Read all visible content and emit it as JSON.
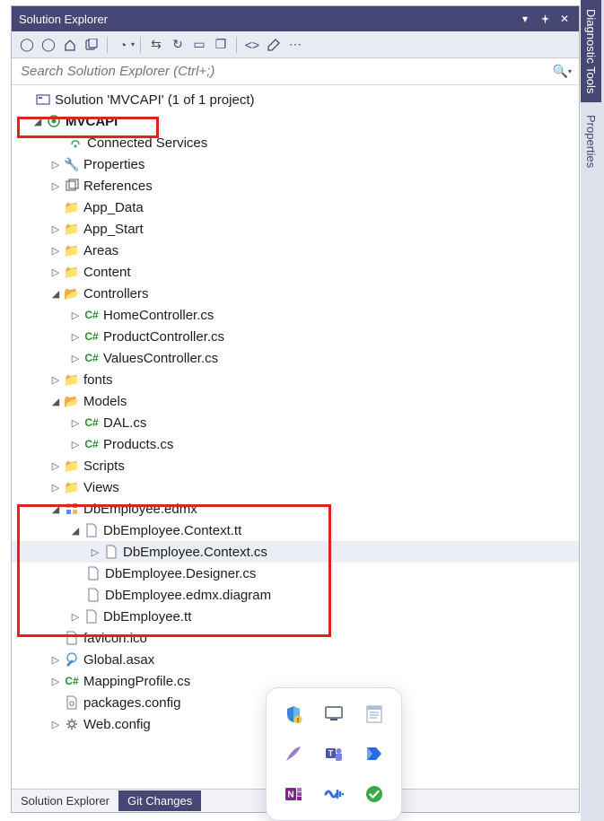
{
  "panel_title": "Solution Explorer",
  "search": {
    "placeholder": "Search Solution Explorer (Ctrl+;)"
  },
  "tree": {
    "solution": "Solution 'MVCAPI' (1 of 1 project)",
    "project": "MVCAPI",
    "connected_services": "Connected Services",
    "properties": "Properties",
    "references": "References",
    "app_data": "App_Data",
    "app_start": "App_Start",
    "areas": "Areas",
    "content": "Content",
    "controllers": "Controllers",
    "home_controller": "HomeController.cs",
    "product_controller": "ProductController.cs",
    "values_controller": "ValuesController.cs",
    "fonts": "fonts",
    "models": "Models",
    "dal": "DAL.cs",
    "products": "Products.cs",
    "scripts": "Scripts",
    "views": "Views",
    "dbemp": "DbEmployee.edmx",
    "dbemp_ctx_tt": "DbEmployee.Context.tt",
    "dbemp_ctx_cs": "DbEmployee.Context.cs",
    "dbemp_designer": "DbEmployee.Designer.cs",
    "dbemp_diag": "DbEmployee.edmx.diagram",
    "dbemp_tt": "DbEmployee.tt",
    "favicon": "favicon.ico",
    "global_asax": "Global.asax",
    "mapping_profile": "MappingProfile.cs",
    "packages": "packages.config",
    "web_config": "Web.config"
  },
  "bottomtabs": {
    "solution_explorer": "Solution Explorer",
    "git_changes": "Git Changes"
  },
  "sidetabs": {
    "diagnostic": "Diagnostic Tools",
    "properties": "Properties"
  }
}
